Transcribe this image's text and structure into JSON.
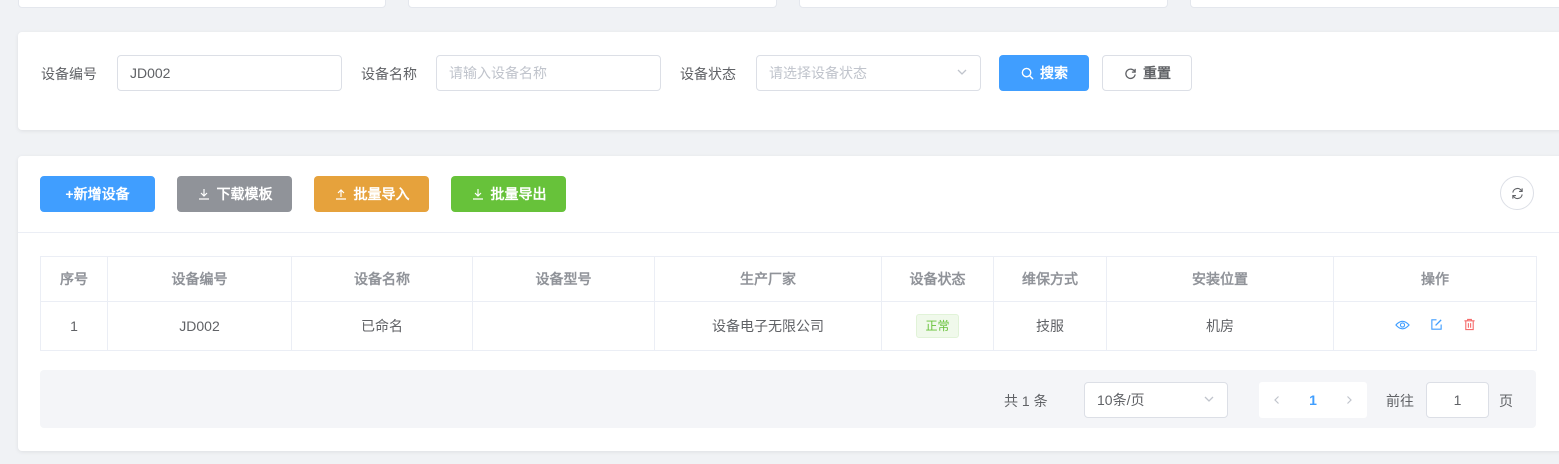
{
  "search": {
    "code_label": "设备编号",
    "code_value": "JD002",
    "name_label": "设备名称",
    "name_placeholder": "请输入设备名称",
    "status_label": "设备状态",
    "status_placeholder": "请选择设备状态",
    "search_button": "搜索",
    "reset_button": "重置"
  },
  "toolbar": {
    "add": "+新增设备",
    "download_template": "下载模板",
    "batch_import": "批量导入",
    "batch_export": "批量导出"
  },
  "table": {
    "columns": [
      "序号",
      "设备编号",
      "设备名称",
      "设备型号",
      "生产厂家",
      "设备状态",
      "维保方式",
      "安装位置",
      "操作"
    ],
    "rows": [
      {
        "index": "1",
        "code": "JD002",
        "name": "已命名",
        "model": "",
        "manufacturer": "设备电子无限公司",
        "status": "正常",
        "maintenance": "技服",
        "location": "机房"
      }
    ]
  },
  "pagination": {
    "total": "共 1 条",
    "page_size": "10条/页",
    "current_page": "1",
    "goto_label": "前往",
    "goto_value": "1",
    "page_suffix": "页"
  },
  "colors": {
    "primary": "#409eff",
    "gray": "#909399",
    "orange": "#e6a23c",
    "green": "#67c23a",
    "danger": "#f56c6c"
  }
}
